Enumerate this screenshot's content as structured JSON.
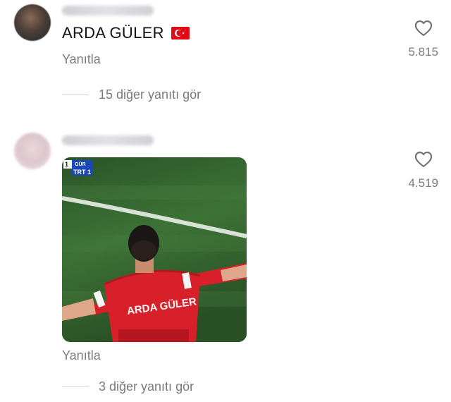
{
  "comments": [
    {
      "comment_text": "ARDA GÜLER",
      "has_flag": true,
      "flag_name": "turkey-flag",
      "reply_label": "Yanıtla",
      "view_replies_label": "15 diğer yanıtı gör",
      "likes": "5.815"
    },
    {
      "gif": {
        "broadcast_score": "1",
        "broadcast_team": "GÜR",
        "broadcast_channel": "TRT 1",
        "jersey_text": "ARDA GÜLER"
      },
      "reply_label": "Yanıtla",
      "view_replies_label": "3 diğer yanıtı gör",
      "likes": "4.519"
    }
  ],
  "colors": {
    "secondary_text": "#7a7a80",
    "pitch_green": "#3f7339",
    "jersey_red": "#d8202a",
    "flag_red": "#e30a17"
  }
}
